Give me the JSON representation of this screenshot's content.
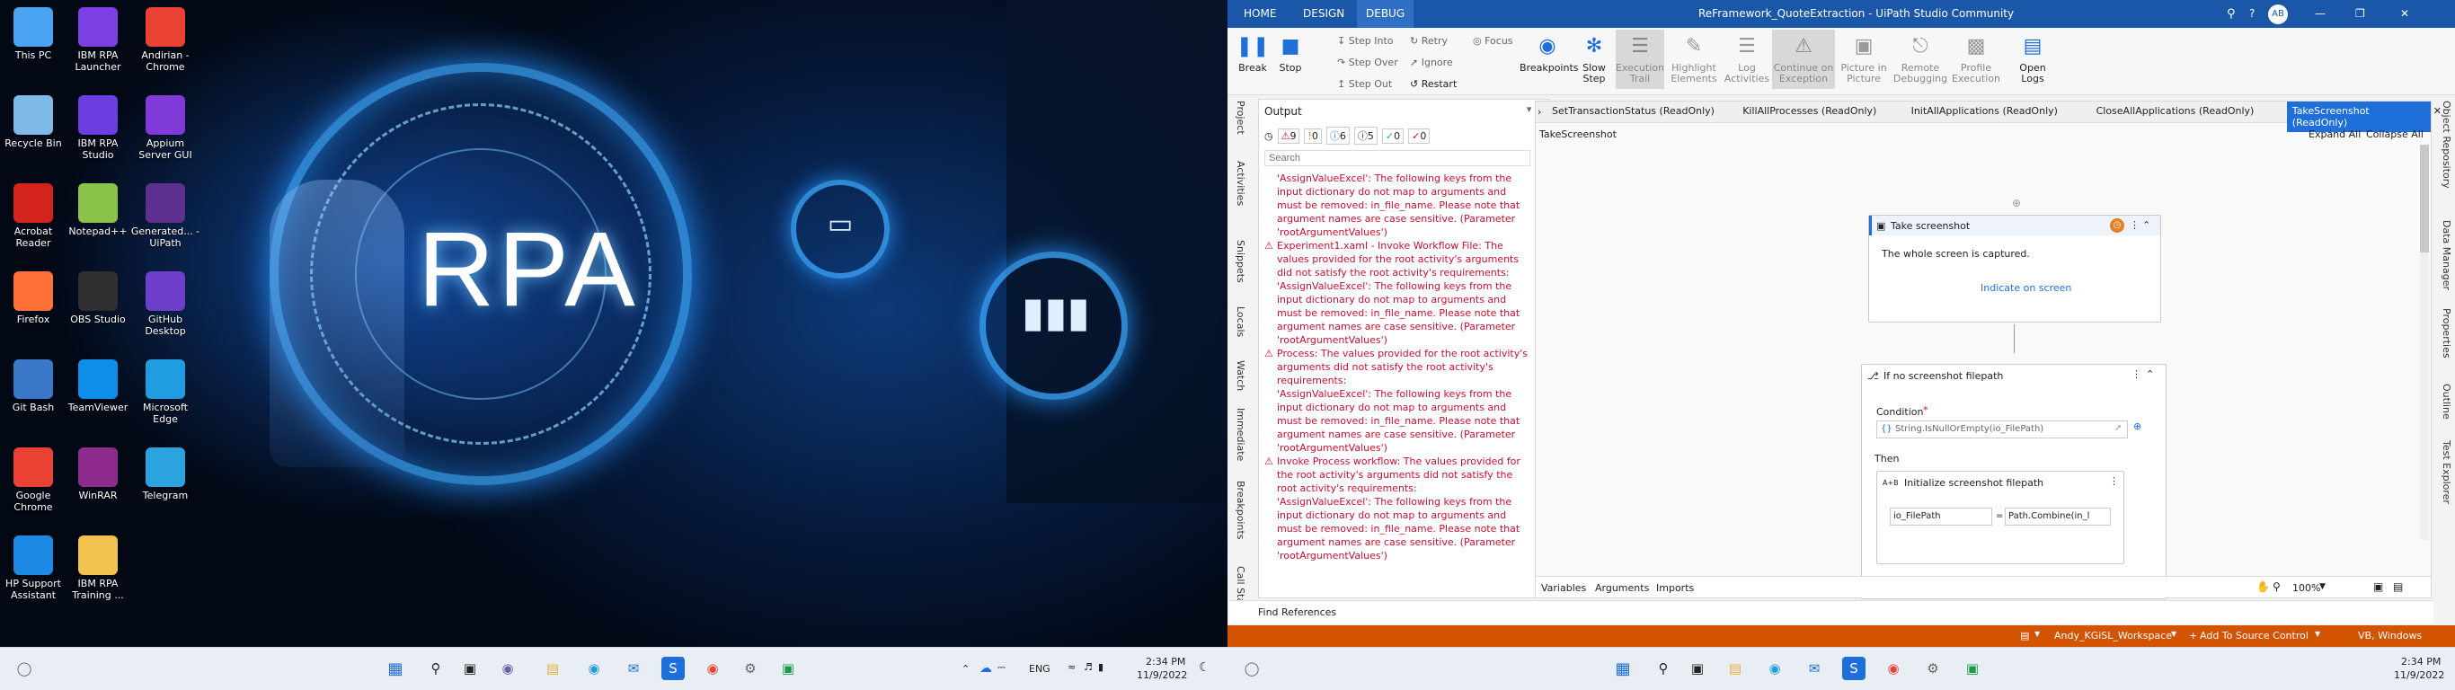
{
  "desktop": {
    "icons": [
      {
        "label": "This PC",
        "icon": "monitor-icon",
        "color": "#4aa3f0"
      },
      {
        "label": "IBM RPA Launcher",
        "icon": "rocket-icon",
        "color": "#7b3fe4"
      },
      {
        "label": "Andirian - Chrome",
        "icon": "chrome-icon",
        "color": "#e94235"
      },
      {
        "label": "Recycle Bin",
        "icon": "recycle-bin-icon",
        "color": "#7fb9e8"
      },
      {
        "label": "IBM RPA Studio",
        "icon": "robot-icon",
        "color": "#6a3ee0"
      },
      {
        "label": "Appium Server GUI",
        "icon": "appium-icon",
        "color": "#7f3ad8"
      },
      {
        "label": "Acrobat Reader",
        "icon": "acrobat-icon",
        "color": "#d4231d"
      },
      {
        "label": "Notepad++",
        "icon": "notepad-icon",
        "color": "#8bc34a"
      },
      {
        "label": "Generated... - UiPath",
        "icon": "uipath-file-icon",
        "color": "#5d2f8f"
      },
      {
        "label": "Firefox",
        "icon": "firefox-icon",
        "color": "#ff7139"
      },
      {
        "label": "OBS Studio",
        "icon": "obs-icon",
        "color": "#302e31"
      },
      {
        "label": "GitHub Desktop",
        "icon": "github-icon",
        "color": "#6e40c9"
      },
      {
        "label": "Git Bash",
        "icon": "git-bash-icon",
        "color": "#3c78c8"
      },
      {
        "label": "TeamViewer",
        "icon": "teamviewer-icon",
        "color": "#0e8ee9"
      },
      {
        "label": "Microsoft Edge",
        "icon": "edge-icon",
        "color": "#1f9de0"
      },
      {
        "label": "Google Chrome",
        "icon": "chrome-icon",
        "color": "#e94235"
      },
      {
        "label": "WinRAR",
        "icon": "winrar-icon",
        "color": "#8e2b8c"
      },
      {
        "label": "Telegram",
        "icon": "telegram-icon",
        "color": "#2aa3df"
      },
      {
        "label": "HP Support Assistant",
        "icon": "hp-question-icon",
        "color": "#1e88e5"
      },
      {
        "label": "IBM RPA Training ...",
        "icon": "folder-icon",
        "color": "#f2c14e"
      }
    ],
    "wallpaper_text": "RPA",
    "taskbar": {
      "lang": "ENG",
      "time": "2:34 PM",
      "date": "11/9/2022"
    }
  },
  "studio": {
    "tabs": [
      "HOME",
      "DESIGN",
      "DEBUG"
    ],
    "active_tab": "DEBUG",
    "window_title": "ReFramework_QuoteExtraction - UiPath Studio Community",
    "user_initials": "AB",
    "ribbon": {
      "break": "Break",
      "stop": "Stop",
      "step_into": "Step Into",
      "step_over": "Step Over",
      "step_out": "Step Out",
      "retry": "Retry",
      "ignore": "Ignore",
      "restart": "Restart",
      "focus": "Focus",
      "breakpoints": "Breakpoints",
      "slow_step": "Slow Step",
      "execution_trail": "Execution Trail",
      "highlight_elements": "Highlight Elements",
      "log_activities": "Log Activities",
      "continue_on_exception": "Continue on Exception",
      "picture_in_picture": "Picture in Picture",
      "remote_debugging": "Remote Debugging",
      "profile_execution": "Profile Execution",
      "open_logs": "Open Logs"
    },
    "left_vtabs": [
      "Project",
      "Activities",
      "Snippets",
      "Locals",
      "Watch",
      "Immediate",
      "Breakpoints",
      "Call Stack"
    ],
    "output": {
      "title": "Output",
      "counts": {
        "errors": "9",
        "warnings": "0",
        "info": "6",
        "trace": "5",
        "ok": "0",
        "fatal": "0"
      },
      "search_placeholder": "Search",
      "lines": [
        {
          "warn": false,
          "text": "'AssignValueExcel': The following keys from the input dictionary do not map to arguments and must be removed: in_file_name.  Please note that argument names are case sensitive. (Parameter 'rootArgumentValues')"
        },
        {
          "warn": true,
          "text": "Experiment1.xaml - Invoke Workflow File: The values provided for the root activity's arguments did not satisfy the root activity's requirements:"
        },
        {
          "warn": false,
          "text": "'AssignValueExcel': The following keys from the input dictionary do not map to arguments and must be removed: in_file_name.  Please note that argument names are case sensitive. (Parameter 'rootArgumentValues')"
        },
        {
          "warn": true,
          "text": "Process: The values provided for the root activity's arguments did not satisfy the root activity's requirements:"
        },
        {
          "warn": false,
          "text": "'AssignValueExcel': The following keys from the input dictionary do not map to arguments and must be removed: in_file_name.  Please note that argument names are case sensitive. (Parameter 'rootArgumentValues')"
        },
        {
          "warn": true,
          "text": "Invoke Process workflow: The values provided for the root activity's arguments did not satisfy the root activity's requirements:"
        },
        {
          "warn": false,
          "text": "'AssignValueExcel': The following keys from the input dictionary do not map to arguments and must be removed: in_file_name.  Please note that argument names are case sensitive. (Parameter 'rootArgumentValues')"
        }
      ]
    },
    "doc_tabs": [
      "SetTransactionStatus (ReadOnly)",
      "KillAllProcesses (ReadOnly)",
      "InitAllApplications (ReadOnly)",
      "CloseAllApplications (ReadOnly)",
      "TakeScreenshot (ReadOnly)"
    ],
    "active_doc_tab": "TakeScreenshot (ReadOnly)",
    "breadcrumb": "TakeScreenshot",
    "expand_all": "Expand All",
    "collapse_all": "Collapse All",
    "designer": {
      "take_screenshot": {
        "title": "Take screenshot",
        "desc": "The whole screen is captured.",
        "link": "Indicate on screen"
      },
      "if": {
        "title": "If no screenshot filepath",
        "condition_label": "Condition",
        "required_mark": "*",
        "condition": "String.IsNullOrEmpty(io_FilePath)",
        "then": "Then"
      },
      "assign": {
        "title": "Initialize screenshot filepath",
        "to": "io_FilePath",
        "eq": "=",
        "value": "Path.Combine(in_l"
      }
    },
    "bottom_tabs": [
      "Variables",
      "Arguments",
      "Imports"
    ],
    "zoom": "100%",
    "find_refs": "Find References",
    "right_vtabs": [
      "Object Repository",
      "Data Manager",
      "Properties",
      "Outline",
      "Test Explorer"
    ],
    "status": {
      "workspace": "Andy_KGiSL_Workspace",
      "source_control": "Add To Source Control",
      "lang": "VB, Windows"
    },
    "taskbar": {
      "time": "2:34 PM",
      "date": "11/9/2022"
    }
  }
}
